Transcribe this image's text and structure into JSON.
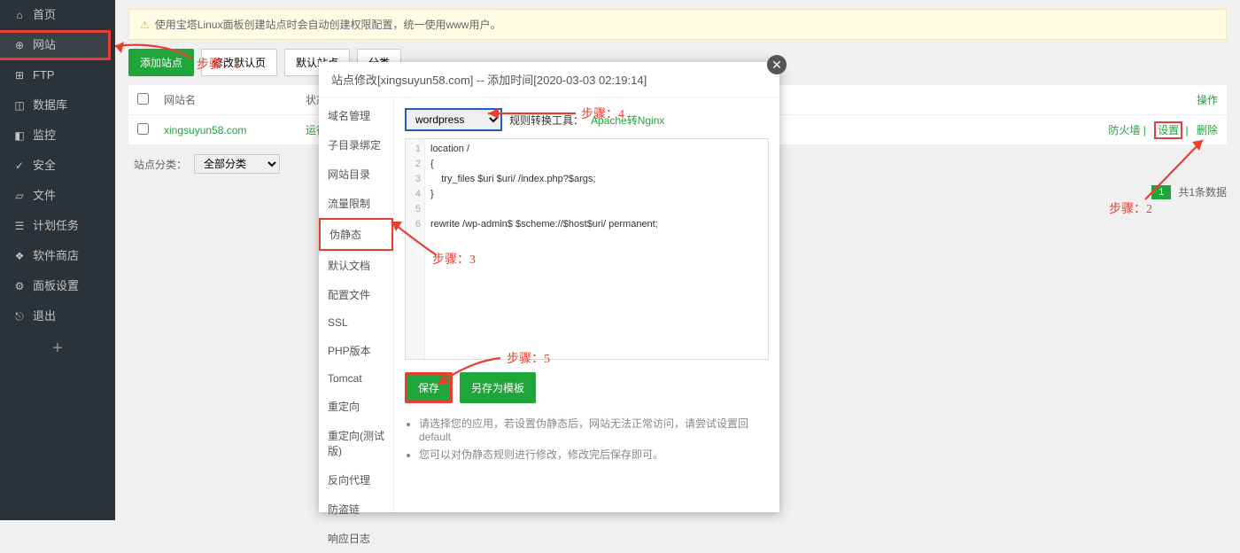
{
  "sidebar": {
    "items": [
      {
        "label": "首页",
        "icon": "⌂"
      },
      {
        "label": "网站",
        "icon": "⊕"
      },
      {
        "label": "FTP",
        "icon": "⊞"
      },
      {
        "label": "数据库",
        "icon": "◫"
      },
      {
        "label": "监控",
        "icon": "◧"
      },
      {
        "label": "安全",
        "icon": "✓"
      },
      {
        "label": "文件",
        "icon": "▱"
      },
      {
        "label": "计划任务",
        "icon": "☰"
      },
      {
        "label": "软件商店",
        "icon": "❖"
      },
      {
        "label": "面板设置",
        "icon": "⚙"
      },
      {
        "label": "退出",
        "icon": "⎋"
      }
    ]
  },
  "notice": "使用宝塔Linux面板创建站点时会自动创建权限配置，统一使用www用户。",
  "toolbar": {
    "add": "添加站点",
    "modifyDefault": "修改默认页",
    "defaultSite": "默认站点",
    "category": "分类"
  },
  "table": {
    "headers": {
      "name": "网站名",
      "status": "状态",
      "ops": "操作"
    },
    "rows": [
      {
        "name": "xingsuyun58.com",
        "status": "运行中 ▶",
        "ops": {
          "firewall": "防火墙",
          "settings": "设置",
          "delete": "删除"
        }
      }
    ],
    "filterLabel": "站点分类：",
    "filterAll": "全部分类",
    "total": "共1条数据",
    "page": "1"
  },
  "modal": {
    "title": "站点修改[xingsuyun58.com] -- 添加时间[2020-03-03 02:19:14]",
    "nav": [
      "域名管理",
      "子目录绑定",
      "网站目录",
      "流量限制",
      "伪静态",
      "默认文档",
      "配置文件",
      "SSL",
      "PHP版本",
      "Tomcat",
      "重定向",
      "重定向(测试版)",
      "反向代理",
      "防盗链",
      "响应日志"
    ],
    "activeNav": "伪静态",
    "ruleSelect": "wordpress",
    "ruleConvLabel": "规则转换工具：",
    "ruleConvLink": "Apache转Nginx",
    "code": "location /\n{\n    try_files $uri $uri/ /index.php?$args;\n}\n\nrewrite /wp-admin$ $scheme://$host$uri/ permanent;",
    "btnSave": "保存",
    "btnSaveAs": "另存为模板",
    "hint1": "请选择您的应用，若设置伪静态后，网站无法正常访问，请尝试设置回default",
    "hint2": "您可以对伪静态规则进行修改，修改完后保存即可。"
  },
  "annotations": {
    "s1": "步骤：1",
    "s2": "步骤：2",
    "s3": "步骤：3",
    "s4": "步骤：4",
    "s5": "步骤：5"
  }
}
